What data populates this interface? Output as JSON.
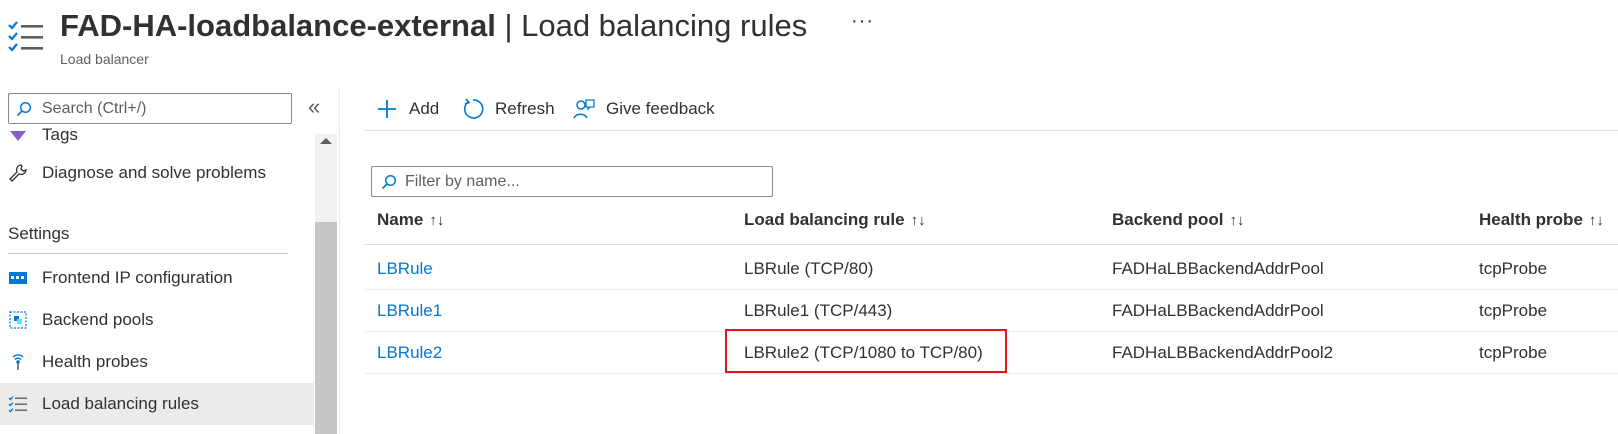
{
  "header": {
    "resource_name": "FAD-HA-loadbalance-external",
    "separator": " | ",
    "blade_title": "Load balancing rules",
    "subtitle": "Load balancer",
    "more_label": "···"
  },
  "sidebar": {
    "search_placeholder": "Search (Ctrl+/)",
    "collapse_label": "«",
    "items_top": [
      {
        "label": "Tags",
        "icon": "tag-icon"
      },
      {
        "label": "Diagnose and solve problems",
        "icon": "wrench-icon"
      }
    ],
    "section_label": "Settings",
    "items": [
      {
        "label": "Frontend IP configuration",
        "icon": "frontend-ip-icon"
      },
      {
        "label": "Backend pools",
        "icon": "backend-pool-icon"
      },
      {
        "label": "Health probes",
        "icon": "health-probe-icon"
      },
      {
        "label": "Load balancing rules",
        "icon": "rules-list-icon",
        "selected": true
      }
    ]
  },
  "toolbar": {
    "add_label": "Add",
    "refresh_label": "Refresh",
    "feedback_label": "Give feedback"
  },
  "filter": {
    "placeholder": "Filter by name..."
  },
  "table": {
    "columns": [
      {
        "label": "Name",
        "sort": "↑↓"
      },
      {
        "label": "Load balancing rule",
        "sort": "↑↓"
      },
      {
        "label": "Backend pool",
        "sort": "↑↓"
      },
      {
        "label": "Health probe",
        "sort": "↑↓"
      }
    ],
    "rows": [
      {
        "name": "LBRule",
        "rule": "LBRule (TCP/80)",
        "pool": "FADHaLBBackendAddrPool",
        "probe": "tcpProbe"
      },
      {
        "name": "LBRule1",
        "rule": "LBRule1 (TCP/443)",
        "pool": "FADHaLBBackendAddrPool",
        "probe": "tcpProbe"
      },
      {
        "name": "LBRule2",
        "rule": "LBRule2 (TCP/1080 to TCP/80)",
        "pool": "FADHaLBBackendAddrPool2",
        "probe": "tcpProbe"
      }
    ]
  },
  "colors": {
    "accent": "#0078d4",
    "highlight_border": "#e3141e",
    "selected_bg": "#edebe9"
  }
}
